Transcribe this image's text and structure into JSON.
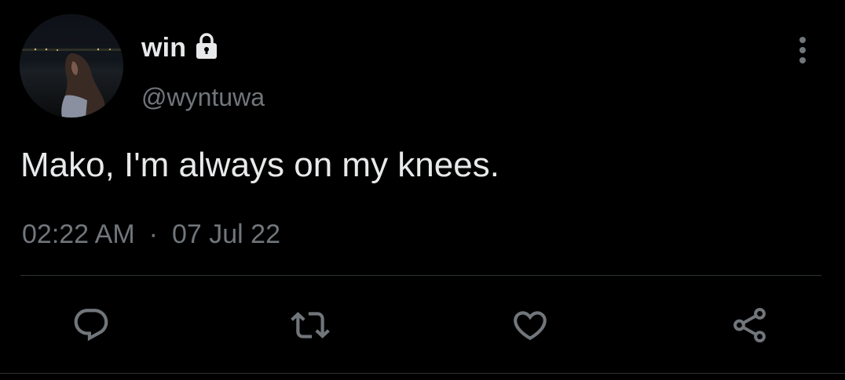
{
  "author": {
    "display_name": "win",
    "handle": "@wyntuwa",
    "protected": true
  },
  "tweet": {
    "text": "Mako, I'm always on my knees.",
    "time": "02:22 AM",
    "separator": "·",
    "date": "07 Jul 22"
  },
  "actions": [
    "reply",
    "retweet",
    "like",
    "share"
  ],
  "colors": {
    "background": "#000000",
    "primary_text": "#e7e9ea",
    "secondary_text": "#71767b",
    "divider": "#2f3336"
  },
  "icons": {
    "lock": "lock-icon",
    "more": "more-vertical-icon",
    "reply": "reply-icon",
    "retweet": "retweet-icon",
    "like": "heart-icon",
    "share": "share-icon"
  }
}
